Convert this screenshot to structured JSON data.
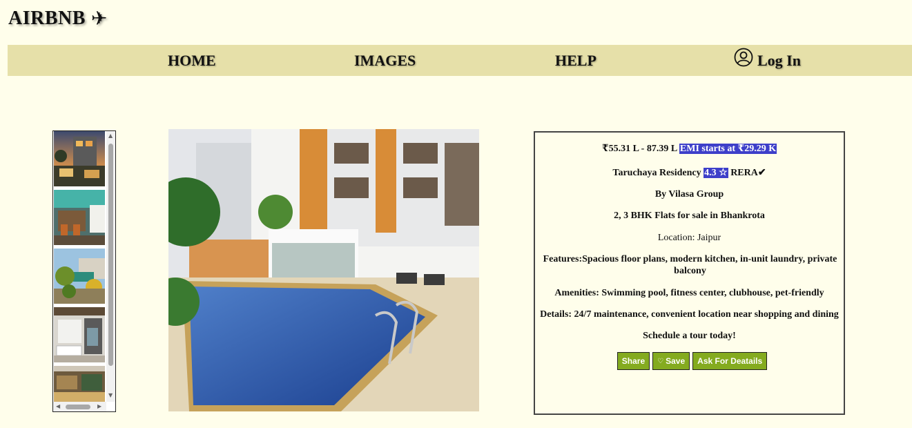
{
  "brand": {
    "name": "AIRBNB",
    "icon": "airplane-icon",
    "glyph": "✈"
  },
  "nav": {
    "home": "HOME",
    "images": "IMAGES",
    "help": "HELP",
    "login": "Log In",
    "login_icon": "user-circle-icon"
  },
  "gallery": {
    "thumbnails": [
      "thumbnail-1",
      "thumbnail-2",
      "thumbnail-3",
      "thumbnail-4",
      "thumbnail-5"
    ]
  },
  "listing": {
    "price": "₹55.31 L - 87.39 L",
    "emi": "EMI starts at ₹29.29 K",
    "name": "Taruchaya Residency",
    "rating": "4.3 ☆",
    "rera": "RERA✔",
    "builder": "By Vilasa Group",
    "type": "2, 3 BHK Flats for sale in Bhankrota",
    "location": "Location: Jaipur",
    "features": "Features:Spacious floor plans, modern kitchen, in-unit laundry, private balcony",
    "amenities": "Amenities: Swimming pool, fitness center, clubhouse, pet-friendly",
    "details": "Details: 24/7 maintenance, convenient location near shopping and dining",
    "cta": "Schedule a tour today!"
  },
  "actions": {
    "share": "Share",
    "save": "Save",
    "save_icon": "heart-icon",
    "ask": "Ask For Deatails"
  },
  "colors": {
    "background": "#fffeeb",
    "navbar": "#e6e0a9",
    "highlight": "#3d3fc9",
    "button": "#84ab1f"
  }
}
